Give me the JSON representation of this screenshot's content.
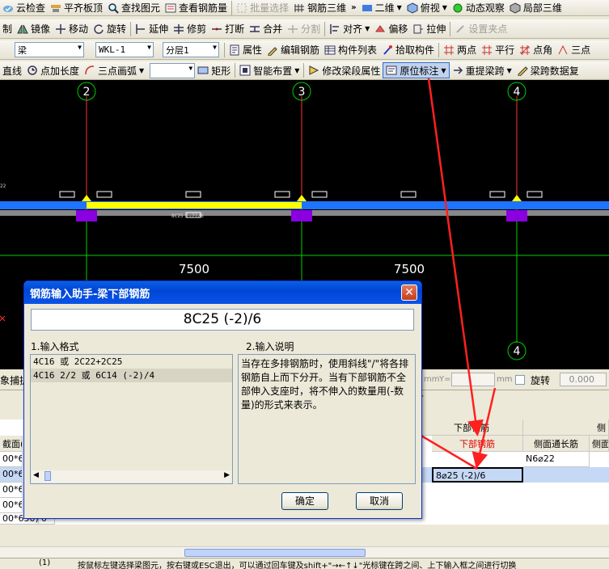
{
  "toolbar1": {
    "items": [
      {
        "label": "云检查"
      },
      {
        "label": "平齐板顶"
      },
      {
        "label": "查找图元"
      },
      {
        "label": "查看钢筋量"
      },
      {
        "label": "批量选择"
      },
      {
        "label": "钢筋三维"
      },
      {
        "label": "二维"
      },
      {
        "label": "俯视"
      },
      {
        "label": "动态观察"
      },
      {
        "label": "局部三维"
      }
    ]
  },
  "toolbar2": {
    "items": [
      {
        "label": "制"
      },
      {
        "label": "镜像"
      },
      {
        "label": "移动"
      },
      {
        "label": "旋转"
      },
      {
        "label": "延伸"
      },
      {
        "label": "修剪"
      },
      {
        "label": "打断"
      },
      {
        "label": "合并"
      },
      {
        "label": "分割"
      },
      {
        "label": "对齐"
      },
      {
        "label": "偏移"
      },
      {
        "label": "拉伸"
      },
      {
        "label": "设置夹点"
      }
    ]
  },
  "toolbar3": {
    "category": "梁",
    "component": "WKL-1",
    "layer": "分层1",
    "items": [
      {
        "label": "属性"
      },
      {
        "label": "编辑钢筋"
      },
      {
        "label": "构件列表"
      },
      {
        "label": "拾取构件"
      },
      {
        "label": "两点"
      },
      {
        "label": "平行"
      },
      {
        "label": "点角"
      },
      {
        "label": "三点"
      }
    ]
  },
  "toolbar4": {
    "items": [
      {
        "label": "直线"
      },
      {
        "label": "点加长度"
      },
      {
        "label": "三点画弧"
      },
      {
        "label": "矩形"
      },
      {
        "label": "智能布置"
      },
      {
        "label": "修改梁段属性"
      },
      {
        "label": "原位标注"
      },
      {
        "label": "重提梁跨"
      },
      {
        "label": "梁跨数据复"
      }
    ]
  },
  "canvas": {
    "axes": [
      "2",
      "3",
      "4",
      "4"
    ],
    "spans": [
      "7500",
      "7500"
    ],
    "beam_label": "8C25 (-2)/6",
    "side_label": "22"
  },
  "bottom": {
    "capture_label": "象捕捉",
    "y_label": "Y=",
    "mm1": "mm",
    "mm2": "mm",
    "rotate_label": "旋转",
    "rotate_value": "0.000",
    "col_group": "下部钢筋",
    "col_bottom": "下部钢筋",
    "col_side": "侧面通长筋",
    "col_side2": "侧面",
    "col_side_group": "侧",
    "col_section": "截面(B",
    "side_value": "N6⌀22",
    "cell_value": "8⌀25 (-2)/6",
    "row_sections": [
      "00*65",
      "00*65",
      "00*65",
      "00*65",
      "00*650)"
    ],
    "row_last_extra": "0"
  },
  "dialog": {
    "title": "钢筋输入助手-梁下部钢筋",
    "input_value": "8C25 (-2)/6",
    "format_header": "1.输入格式",
    "desc_header": "2.输入说明",
    "formats": [
      "4C16 或 2C22+2C25",
      "4C16 2/2 或 6C14 (-2)/4"
    ],
    "description": "当存在多排钢筋时，使用斜线\"/\"将各排钢筋自上而下分开。当有下部钢筋不全部伸入支座时，将不伸入的数量用(-数量)的形式来表示。",
    "ok_label": "确定",
    "cancel_label": "取消"
  },
  "status_text": "按鼠标左键选择梁图元，按右键或ESC退出，可以通过回车键及shift+\"→←↑↓\"光标键在跨之间、上下输入框之间进行切换",
  "status_prefix": "(1)",
  "colors": {
    "beam_blue": "#1e73ff",
    "beam_yellow": "#ffff00",
    "column_purple": "#8a00e0",
    "axis_red": "#ff3030",
    "axis_green": "#00d000",
    "annotation_red": "#ff2020"
  }
}
